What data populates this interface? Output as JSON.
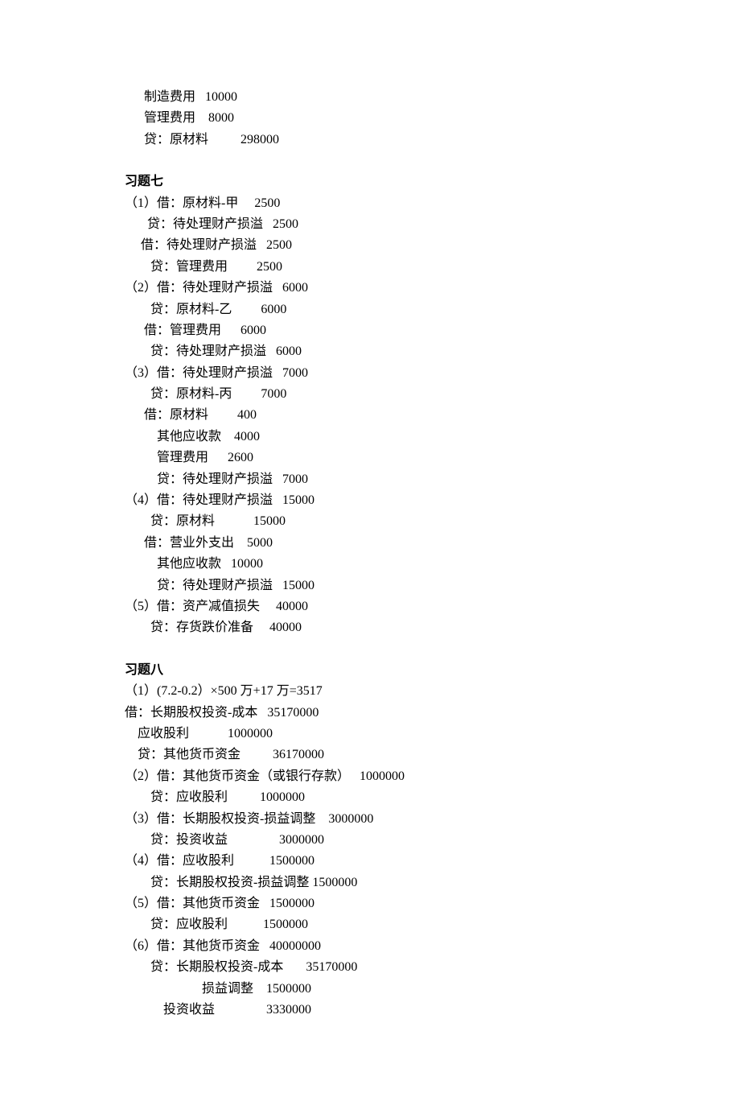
{
  "intro": [
    "      制造费用   10000",
    "      管理费用    8000",
    "      贷：原材料          298000"
  ],
  "ex7": {
    "title": "习题七",
    "lines": [
      "（1）借：原材料-甲     2500",
      "       贷：待处理财产损溢   2500",
      "     借：待处理财产损溢   2500",
      "        贷：管理费用         2500",
      "（2）借：待处理财产损溢   6000",
      "        贷：原材料-乙         6000",
      "      借：管理费用      6000",
      "        贷：待处理财产损溢   6000",
      "（3）借：待处理财产损溢   7000",
      "        贷：原材料-丙         7000",
      "      借：原材料         400",
      "          其他应收款    4000",
      "          管理费用      2600",
      "          贷：待处理财产损溢   7000",
      "（4）借：待处理财产损溢   15000",
      "        贷：原材料            15000",
      "      借：营业外支出    5000",
      "          其他应收款   10000",
      "          贷：待处理财产损溢   15000",
      "（5）借：资产减值损失     40000",
      "        贷：存货跌价准备     40000"
    ]
  },
  "ex8": {
    "title": "习题八",
    "lines": [
      "（1）(7.2-0.2）×500 万+17 万=3517",
      "借：长期股权投资-成本   35170000",
      "    应收股利            1000000",
      "    贷：其他货币资金          36170000",
      "（2）借：其他货币资金（或银行存款）   1000000",
      "        贷：应收股利          1000000",
      "（3）借：长期股权投资-损益调整    3000000",
      "        贷：投资收益                3000000",
      "（4）借：应收股利           1500000",
      "        贷：长期股权投资-损益调整 1500000",
      "（5）借：其他货币资金   1500000",
      "        贷：应收股利           1500000",
      "（6）借：其他货币资金   40000000",
      "        贷：长期股权投资-成本       35170000",
      "                        损益调整    1500000",
      "            投资收益                3330000"
    ]
  }
}
